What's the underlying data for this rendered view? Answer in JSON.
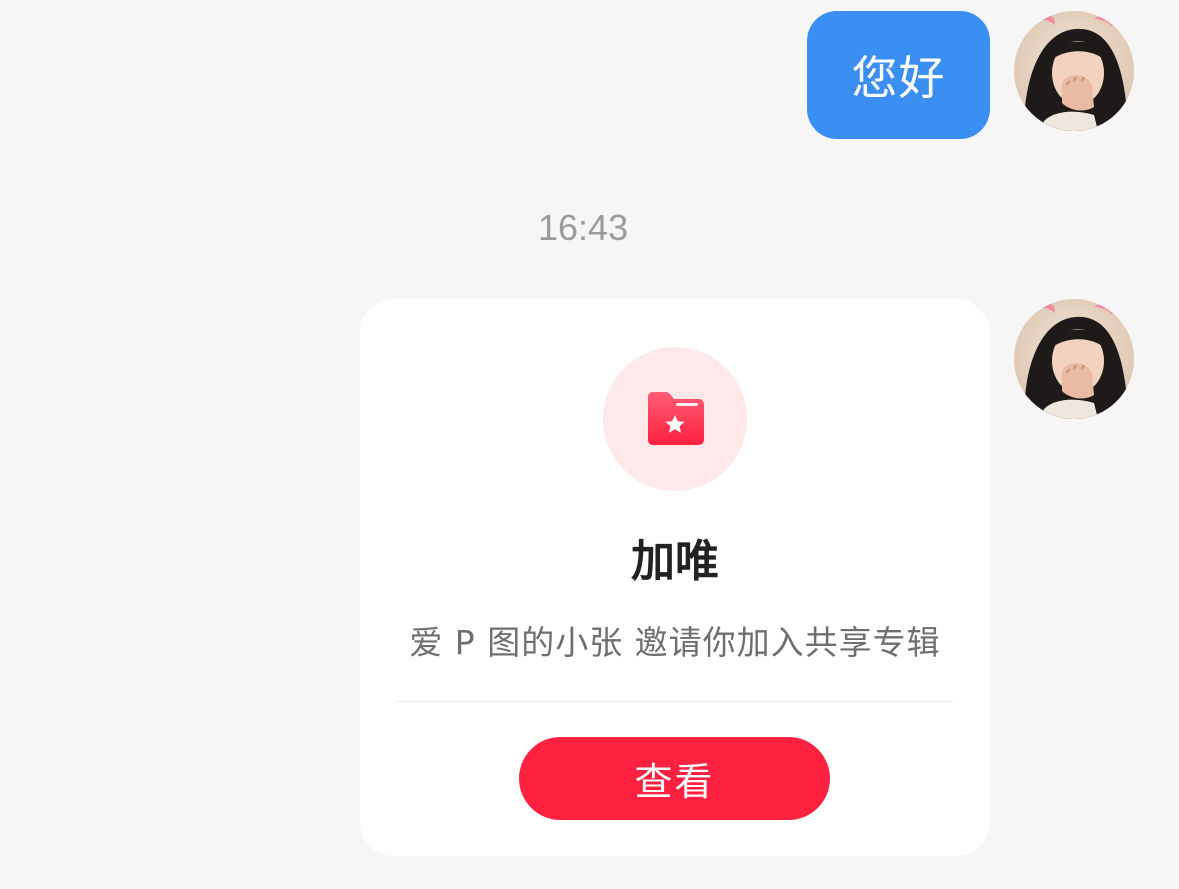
{
  "messages": {
    "text_bubble": {
      "text": "您好"
    },
    "timestamp": "16:43",
    "album_card": {
      "icon": "folder-star-icon",
      "title": "加唯",
      "description": "爱 P 图的小张 邀请你加入共享专辑",
      "button_label": "查看"
    }
  },
  "colors": {
    "background": "#f6f6f6",
    "bubble_blue": "#3b8ff3",
    "accent_red": "#ff2140",
    "icon_circle": "#fde8ea",
    "timestamp_gray": "#9b9b9b"
  }
}
